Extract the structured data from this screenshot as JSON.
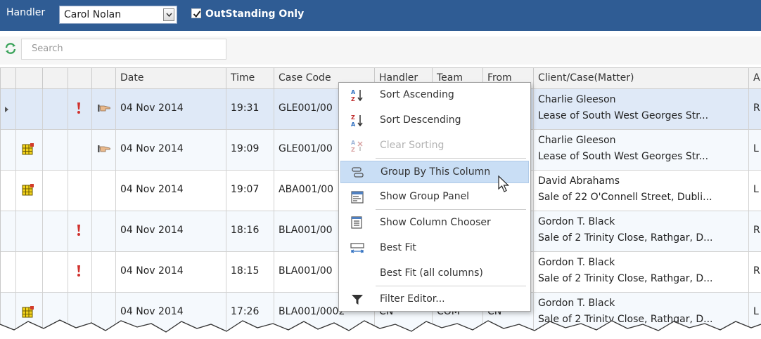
{
  "toolbar": {
    "handler_label": "Handler",
    "handler_value": "Carol Nolan",
    "outstanding_label": "OutStanding Only",
    "outstanding_checked": true
  },
  "search": {
    "placeholder": "Search"
  },
  "columns": [
    "",
    "",
    "",
    "",
    "Date",
    "Time",
    "Case Code",
    "Handler",
    "Team",
    "From",
    "Client/Case(Matter)",
    "A"
  ],
  "rows": [
    {
      "date": "04 Nov 2014",
      "time": "19:31",
      "case": "GLE001/00",
      "handler": "",
      "team": "",
      "from": "",
      "client": "Charlie Gleeson",
      "matter": "Lease of South West Georges Str...",
      "extra": "R",
      "flag": true,
      "hand": true,
      "grid": false,
      "selected": true
    },
    {
      "date": "04 Nov 2014",
      "time": "19:09",
      "case": "GLE001/00",
      "handler": "",
      "team": "",
      "from": "",
      "client": "Charlie Gleeson",
      "matter": "Lease of South West Georges Str...",
      "extra": "L",
      "flag": false,
      "hand": true,
      "grid": true,
      "selected": false
    },
    {
      "date": "04 Nov 2014",
      "time": "19:07",
      "case": "ABA001/00",
      "handler": "",
      "team": "",
      "from": "",
      "client": "David Abrahams",
      "matter": "Sale of 22 O'Connell Street, Dubli...",
      "extra": "L",
      "flag": false,
      "hand": false,
      "grid": true,
      "selected": false
    },
    {
      "date": "04 Nov 2014",
      "time": "18:16",
      "case": "BLA001/00",
      "handler": "",
      "team": "",
      "from": "",
      "client": "Gordon T. Black",
      "matter": "Sale of 2 Trinity Close, Rathgar, D...",
      "extra": "R",
      "flag": true,
      "hand": false,
      "grid": false,
      "selected": false
    },
    {
      "date": "04 Nov 2014",
      "time": "18:15",
      "case": "BLA001/00",
      "handler": "",
      "team": "",
      "from": "",
      "client": "Gordon T. Black",
      "matter": "Sale of 2 Trinity Close, Rathgar, D...",
      "extra": "R",
      "flag": true,
      "hand": false,
      "grid": false,
      "selected": false
    },
    {
      "date": "04 Nov 2014",
      "time": "17:26",
      "case": "BLA001/0002",
      "handler": "CN",
      "team": "COM",
      "from": "CN",
      "client": "Gordon T. Black",
      "matter": "Sale of 2 Trinity Close, Rathgar, D...",
      "extra": "L",
      "flag": false,
      "hand": false,
      "grid": true,
      "selected": false
    }
  ],
  "context_menu": {
    "items": [
      {
        "label": "Sort Ascending",
        "icon": "sort-ascending-icon",
        "disabled": false
      },
      {
        "label": "Sort Descending",
        "icon": "sort-descending-icon",
        "disabled": false
      },
      {
        "label": "Clear Sorting",
        "icon": "clear-sorting-icon",
        "disabled": true
      },
      {
        "label": "Group By This Column",
        "icon": "group-by-icon",
        "disabled": false,
        "highlighted": true
      },
      {
        "label": "Show Group Panel",
        "icon": "group-panel-icon",
        "disabled": false
      },
      {
        "label": "Show Column Chooser",
        "icon": "column-chooser-icon",
        "disabled": false
      },
      {
        "label": "Best Fit",
        "icon": "best-fit-icon",
        "disabled": false
      },
      {
        "label": "Best Fit (all columns)",
        "icon": "",
        "disabled": false
      },
      {
        "label": "Filter Editor...",
        "icon": "filter-icon",
        "disabled": false
      }
    ]
  },
  "colors": {
    "titlebar": "#2f5c94",
    "selected_row": "#dfe9f7",
    "menu_highlight": "#c9def5",
    "flag": "#d0312d"
  }
}
